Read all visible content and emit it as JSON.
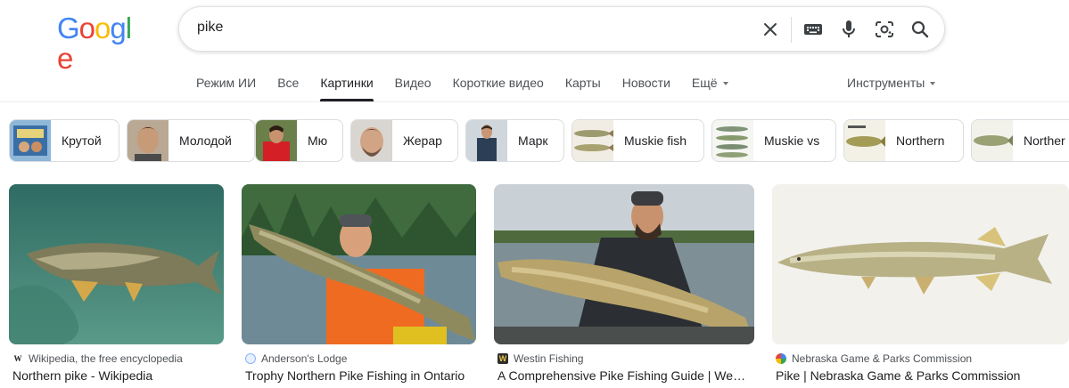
{
  "logo": {
    "letters": [
      "G",
      "o",
      "o",
      "g",
      "l",
      "e"
    ],
    "colors": [
      "#4285F4",
      "#EA4335",
      "#FBBC05",
      "#4285F4",
      "#34A853",
      "#EA4335"
    ]
  },
  "search": {
    "value": "pike",
    "placeholder": ""
  },
  "tabs": [
    {
      "label": "Режим ИИ",
      "active": false
    },
    {
      "label": "Все",
      "active": false
    },
    {
      "label": "Картинки",
      "active": true
    },
    {
      "label": "Видео",
      "active": false
    },
    {
      "label": "Короткие видео",
      "active": false
    },
    {
      "label": "Карты",
      "active": false
    },
    {
      "label": "Новости",
      "active": false
    },
    {
      "label": "Ещё",
      "active": false
    }
  ],
  "tools_label": "Инструменты",
  "chips": [
    {
      "label": "Крутой"
    },
    {
      "label": "Молодой"
    },
    {
      "label": "Мю"
    },
    {
      "label": "Жерар"
    },
    {
      "label": "Марк"
    },
    {
      "label": "Muskie fish"
    },
    {
      "label": "Muskie vs"
    },
    {
      "label": "Northern"
    },
    {
      "label": "Norther"
    }
  ],
  "results": [
    {
      "source": "Wikipedia, the free encyclopedia",
      "title": "Northern pike - Wikipedia",
      "favicon": "W"
    },
    {
      "source": "Anderson's Lodge",
      "title": "Trophy Northern Pike Fishing in Ontario",
      "favicon": ""
    },
    {
      "source": "Westin Fishing",
      "title": "A Comprehensive Pike Fishing Guide | Westin",
      "favicon": ""
    },
    {
      "source": "Nebraska Game & Parks Commission",
      "title": "Pike | Nebraska Game & Parks Commission",
      "favicon": ""
    }
  ],
  "icons": {
    "clear": "close-icon",
    "keyboard": "keyboard-icon",
    "voice": "microphone-icon",
    "lens": "lens-camera-icon",
    "search": "search-icon"
  }
}
